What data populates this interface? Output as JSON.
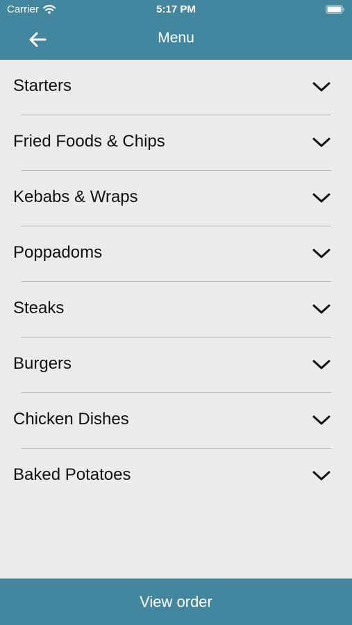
{
  "status_bar": {
    "carrier": "Carrier",
    "time": "5:17 PM",
    "wifi_icon": "wifi-icon",
    "battery_icon": "battery-icon"
  },
  "navbar": {
    "title": "Menu",
    "back_icon": "arrow-left-icon"
  },
  "menu": {
    "items": [
      {
        "label": "Starters"
      },
      {
        "label": "Fried Foods & Chips"
      },
      {
        "label": "Kebabs & Wraps"
      },
      {
        "label": "Poppadoms"
      },
      {
        "label": "Steaks"
      },
      {
        "label": "Burgers"
      },
      {
        "label": "Chicken Dishes"
      },
      {
        "label": "Baked Potatoes"
      }
    ],
    "expand_icon": "chevron-down-icon"
  },
  "footer": {
    "button_label": "View order"
  },
  "colors": {
    "accent": "#44869e",
    "background": "#ebebeb",
    "separator": "#b4b4b4",
    "text": "#111111"
  }
}
